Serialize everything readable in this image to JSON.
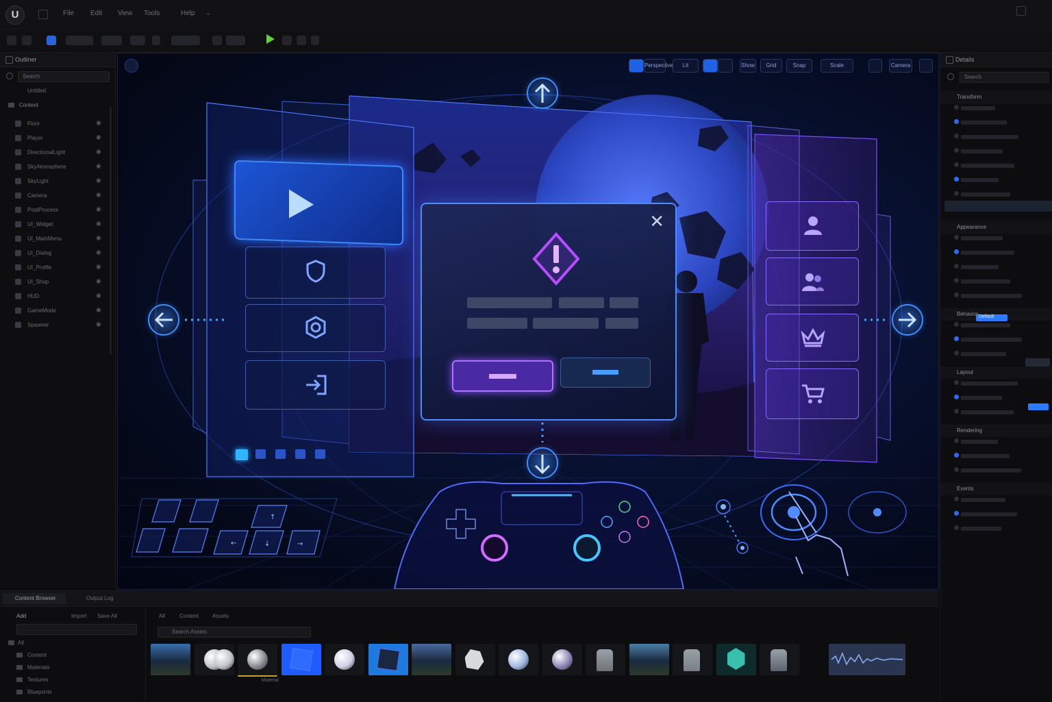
{
  "window": {
    "logo": "U"
  },
  "menubar": {
    "items": [
      "File",
      "Edit",
      "View",
      "Tools",
      "Help"
    ]
  },
  "toolbar": {
    "play_label": "Play",
    "play_color": "#5fd23c"
  },
  "outliner": {
    "title": "Outliner",
    "search_placeholder": "Search",
    "root": "Untitled",
    "folder": "Content",
    "items": [
      "Floor",
      "Player",
      "DirectionalLight",
      "SkyAtmosphere",
      "SkyLight",
      "Camera",
      "PostProcess",
      "UI_Widget",
      "UI_MainMenu",
      "UI_Dialog",
      "UI_Profile",
      "UI_Shop",
      "HUD",
      "GameMode",
      "Spawner"
    ]
  },
  "details": {
    "title": "Details",
    "search_placeholder": "Search",
    "sections": [
      "Transform",
      "Appearance",
      "Behavior",
      "Layout",
      "Rendering",
      "Events"
    ],
    "highlight_value": "Default",
    "accent": "#2a7bff"
  },
  "viewport": {
    "toolbar_items": [
      "Perspective",
      "Lit",
      "Show",
      "Grid",
      "Snap",
      "Scale",
      "Camera"
    ],
    "dialog": {
      "accent": "#b84dff",
      "confirm_color": "#b072ff",
      "cancel_color": "#4a9cff"
    },
    "menu_buttons": [
      "play-icon",
      "shield-icon",
      "gear-icon",
      "exit-icon"
    ],
    "side_buttons": [
      "user-icon",
      "users-icon",
      "crown-icon",
      "cart-icon"
    ],
    "page_dots": 5,
    "active_dot": 0
  },
  "content_browser": {
    "tabs": [
      "Content Browser",
      "Output Log"
    ],
    "toolbar": [
      "Add",
      "Import",
      "Save All"
    ],
    "path": [
      "All",
      "Content",
      "Assets"
    ],
    "search_placeholder": "Search Assets",
    "tree": [
      "All",
      "Content",
      "Materials",
      "Textures",
      "Blueprints"
    ],
    "asset_colors": [
      "#3a6fae",
      "#bfc2c8",
      "#8a8c92",
      "#1f5cff",
      "#cfd0e6",
      "#1e3354",
      "#4a6a9c",
      "#d9dadd",
      "#9db8dd",
      "#8f86b8",
      "#6f7378",
      "#4a7ea8",
      "#7a7f86",
      "#3fd9c5",
      "#5a6470",
      "#2a3550"
    ],
    "selected_label": "Material"
  }
}
